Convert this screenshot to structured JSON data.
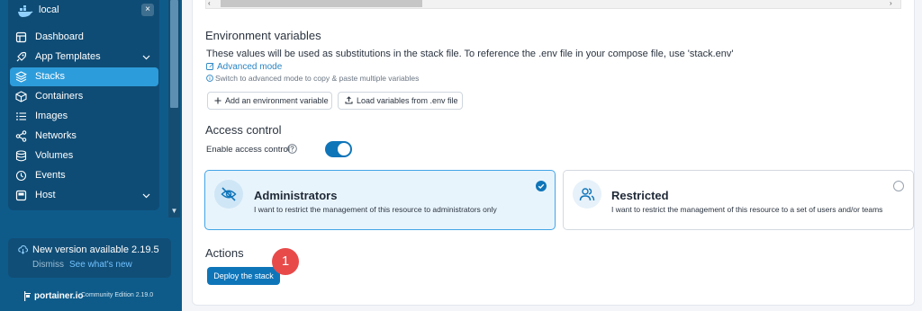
{
  "sidebar": {
    "environment": "local",
    "close_symbol": "×",
    "items": [
      {
        "label": "Dashboard",
        "icon": "dashboard-icon"
      },
      {
        "label": "App Templates",
        "icon": "rocket-icon",
        "expandable": true
      },
      {
        "label": "Stacks",
        "icon": "layers-icon",
        "active": true
      },
      {
        "label": "Containers",
        "icon": "cube-icon"
      },
      {
        "label": "Images",
        "icon": "list-icon"
      },
      {
        "label": "Networks",
        "icon": "share-icon"
      },
      {
        "label": "Volumes",
        "icon": "database-icon"
      },
      {
        "label": "Events",
        "icon": "history-icon"
      },
      {
        "label": "Host",
        "icon": "server-icon",
        "expandable": true
      }
    ],
    "update": {
      "title": "New version available 2.19.5",
      "dismiss": "Dismiss",
      "whats_new": "See what's new"
    },
    "brand": {
      "name": "portainer.io",
      "edition": "Community Edition 2.19.0"
    }
  },
  "main": {
    "env_section": {
      "title": "Environment variables",
      "description": "These values will be used as substitutions in the stack file. To reference the .env file in your compose file, use 'stack.env'",
      "advanced_link": "Advanced mode",
      "advanced_hint": "Switch to advanced mode to copy & paste multiple variables",
      "add_button": "Add an environment variable",
      "load_button": "Load variables from .env file"
    },
    "access_section": {
      "title": "Access control",
      "toggle_label": "Enable access control",
      "enabled": true,
      "options": [
        {
          "title": "Administrators",
          "desc": "I want to restrict the management of this resource to administrators only",
          "selected": true
        },
        {
          "title": "Restricted",
          "desc": "I want to restrict the management of this resource to a set of users and/or teams",
          "selected": false
        }
      ]
    },
    "actions_section": {
      "title": "Actions",
      "deploy_button": "Deploy the stack",
      "step_badge": "1"
    }
  },
  "colors": {
    "sidebar_bg": "#0e5b8a",
    "sidebar_active": "#2d9cdb",
    "primary": "#0f75b9",
    "link": "#2a85c4",
    "badge": "#e84a4a",
    "selected_border": "#42a5e7"
  }
}
